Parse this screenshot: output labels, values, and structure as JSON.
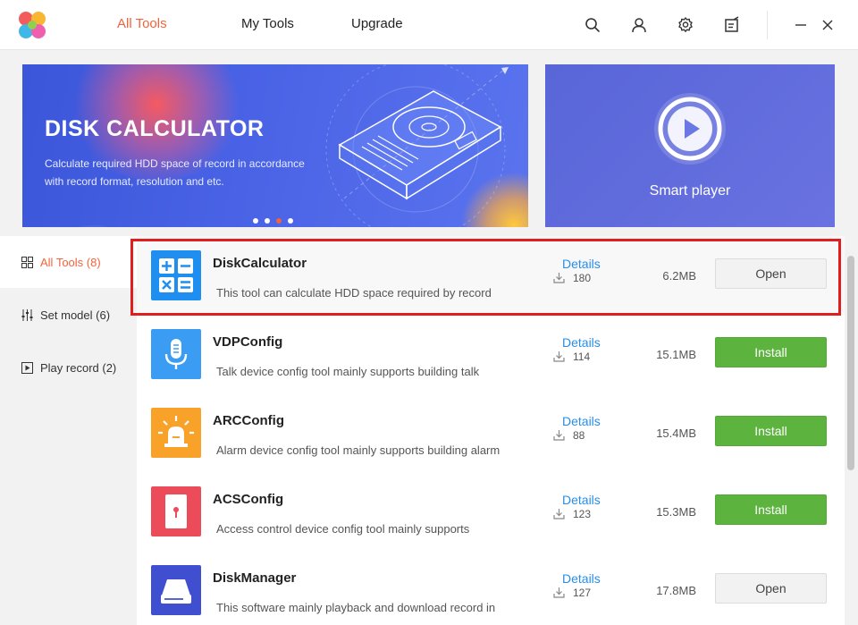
{
  "nav": {
    "tabs": [
      {
        "label": "All Tools",
        "active": true
      },
      {
        "label": "My Tools",
        "active": false
      },
      {
        "label": "Upgrade",
        "active": false
      }
    ],
    "icons": [
      "search-icon",
      "user-icon",
      "gear-icon",
      "notes-icon"
    ],
    "window_controls": [
      "minimize-icon",
      "close-icon"
    ]
  },
  "banner": {
    "title": "DISK CALCULATOR",
    "desc": "Calculate required HDD space of record in accordance with record format, resolution and etc.",
    "dots_count": 4,
    "active_dot": 3
  },
  "side_banner": {
    "label": "Smart player"
  },
  "sidebar": {
    "items": [
      {
        "label": "All Tools (8)",
        "icon": "grid-icon",
        "active": true
      },
      {
        "label": "Set model (6)",
        "icon": "sliders-icon",
        "active": false
      },
      {
        "label": "Play record (2)",
        "icon": "play-box-icon",
        "active": false
      }
    ]
  },
  "tools": [
    {
      "name": "DiskCalculator",
      "desc": "This tool can calculate HDD space required by record",
      "details": "Details",
      "downloads": "180",
      "size": "6.2MB",
      "action": "Open",
      "icon": "calculator-icon"
    },
    {
      "name": "VDPConfig",
      "desc": "Talk device config tool mainly supports building talk",
      "details": "Details",
      "downloads": "114",
      "size": "15.1MB",
      "action": "Install",
      "icon": "microphone-icon"
    },
    {
      "name": "ARCConfig",
      "desc": "Alarm device config tool mainly supports building alarm",
      "details": "Details",
      "downloads": "88",
      "size": "15.4MB",
      "action": "Install",
      "icon": "alarm-icon"
    },
    {
      "name": "ACSConfig",
      "desc": "Access control device config tool mainly supports",
      "details": "Details",
      "downloads": "123",
      "size": "15.3MB",
      "action": "Install",
      "icon": "door-icon"
    },
    {
      "name": "DiskManager",
      "desc": "This software mainly playback and download record in",
      "details": "Details",
      "downloads": "127",
      "size": "17.8MB",
      "action": "Open",
      "icon": "drive-icon"
    }
  ],
  "colors": {
    "accent": "#f0643c",
    "link": "#2a8ee8",
    "install": "#5cb43f",
    "highlight_frame": "#e01e1e"
  }
}
